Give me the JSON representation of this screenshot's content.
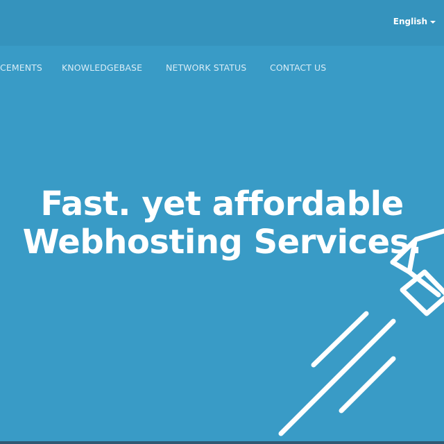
{
  "header": {
    "language": "English"
  },
  "nav": {
    "items": [
      {
        "label": "CEMENTS"
      },
      {
        "label": "KNOWLEDGEBASE"
      },
      {
        "label": "NETWORK STATUS"
      },
      {
        "label": "CONTACT US"
      }
    ]
  },
  "hero": {
    "line1": "Fast. yet affordable",
    "line2": "Webhosting Services."
  },
  "illustration": {
    "icon": "rocket-icon"
  },
  "colors": {
    "background": "#399bc6",
    "topbar": "#3593bd",
    "text": "#ffffff"
  }
}
